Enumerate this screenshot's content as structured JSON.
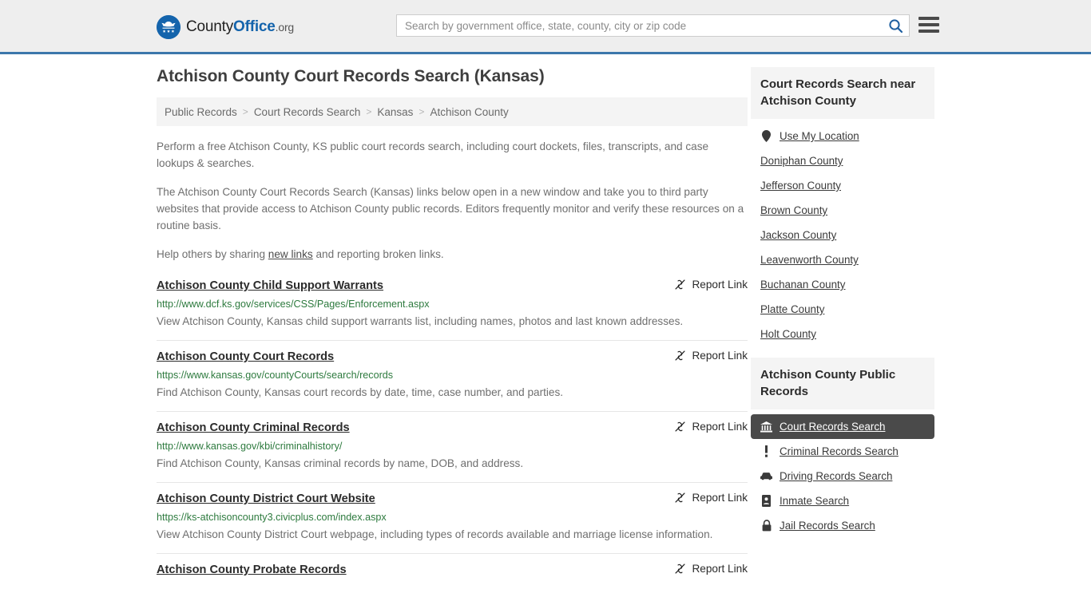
{
  "header": {
    "logo": {
      "icon": "eagle-seal-icon",
      "text_a": "County",
      "text_b": "Office",
      "text_org": ".org"
    },
    "search": {
      "placeholder": "Search by government office, state, county, city or zip code",
      "value": "",
      "search_icon": "search-icon"
    },
    "menu_icon": "hamburger-menu-icon"
  },
  "main": {
    "title": "Atchison County Court Records Search (Kansas)",
    "breadcrumb": [
      "Public Records",
      "Court Records Search",
      "Kansas",
      "Atchison County"
    ],
    "breadcrumb_separator": ">",
    "intro": [
      "Perform a free Atchison County, KS public court records search, including court dockets, files, transcripts, and case lookups & searches.",
      "The Atchison County Court Records Search (Kansas) links below open in a new window and take you to third party websites that provide access to Atchison County public records. Editors frequently monitor and verify these resources on a routine basis."
    ],
    "help_prefix": "Help others by sharing ",
    "help_link": "new links",
    "help_suffix": " and reporting broken links.",
    "report_link_label": "Report Link",
    "report_link_icon": "broken-link-icon",
    "results": [
      {
        "title": "Atchison County Child Support Warrants",
        "url": "http://www.dcf.ks.gov/services/CSS/Pages/Enforcement.aspx",
        "description": "View Atchison County, Kansas child support warrants list, including names, photos and last known addresses."
      },
      {
        "title": "Atchison County Court Records",
        "url": "https://www.kansas.gov/countyCourts/search/records",
        "description": "Find Atchison County, Kansas court records by date, time, case number, and parties."
      },
      {
        "title": "Atchison County Criminal Records",
        "url": "http://www.kansas.gov/kbi/criminalhistory/",
        "description": "Find Atchison County, Kansas criminal records by name, DOB, and address."
      },
      {
        "title": "Atchison County District Court Website",
        "url": "https://ks-atchisoncounty3.civicplus.com/index.aspx",
        "description": "View Atchison County District Court webpage, including types of records available and marriage license information."
      },
      {
        "title": "Atchison County Probate Records",
        "url": "",
        "description": ""
      }
    ]
  },
  "sidebar": {
    "nearby": {
      "title": "Court Records Search near Atchison County",
      "items": [
        {
          "label": "Use My Location",
          "icon": "map-pin-icon"
        },
        {
          "label": "Doniphan County",
          "icon": ""
        },
        {
          "label": "Jefferson County",
          "icon": ""
        },
        {
          "label": "Brown County",
          "icon": ""
        },
        {
          "label": "Jackson County",
          "icon": ""
        },
        {
          "label": "Leavenworth County",
          "icon": ""
        },
        {
          "label": "Buchanan County",
          "icon": ""
        },
        {
          "label": "Platte County",
          "icon": ""
        },
        {
          "label": "Holt County",
          "icon": ""
        }
      ]
    },
    "public_records": {
      "title": "Atchison County Public Records",
      "items": [
        {
          "label": "Court Records Search",
          "icon": "courthouse-icon",
          "active": true
        },
        {
          "label": "Criminal Records Search",
          "icon": "exclamation-icon",
          "active": false
        },
        {
          "label": "Driving Records Search",
          "icon": "car-icon",
          "active": false
        },
        {
          "label": "Inmate Search",
          "icon": "id-badge-icon",
          "active": false
        },
        {
          "label": "Jail Records Search",
          "icon": "lock-icon",
          "active": false
        }
      ]
    }
  },
  "colors": {
    "header_bg": "#eeeeee",
    "header_border": "#3c77ab",
    "brand_blue": "#1464ac",
    "url_green": "#2d7a3e",
    "active_bg": "#4a4a4a",
    "panel_bg": "#f4f4f4"
  }
}
